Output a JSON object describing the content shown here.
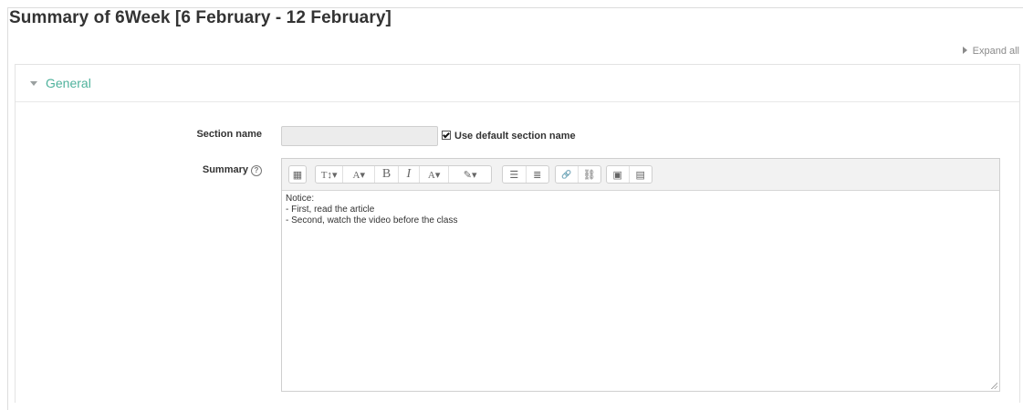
{
  "page": {
    "title": "Summary of 6Week [6 February - 12 February]",
    "expand_all": "Expand all"
  },
  "general": {
    "legend": "General"
  },
  "form": {
    "section_name_label": "Section name",
    "section_name_value": "",
    "use_default_label": "Use default section name",
    "use_default_checked": true,
    "summary_label": "Summary"
  },
  "toolbar": {
    "buttons": [
      {
        "name": "show-more-buttons",
        "glyph": "▦"
      },
      {
        "name": "paragraph-styles",
        "glyph": "T↕▾"
      },
      {
        "name": "text-style",
        "glyph": "A▾"
      },
      {
        "name": "bold",
        "glyph": "B"
      },
      {
        "name": "italic",
        "glyph": "I"
      },
      {
        "name": "font-color",
        "glyph": "A▾"
      },
      {
        "name": "background-color",
        "glyph": "✎▾"
      },
      {
        "name": "unordered-list",
        "glyph": "☰"
      },
      {
        "name": "ordered-list",
        "glyph": "≣"
      },
      {
        "name": "link",
        "glyph": "🔗"
      },
      {
        "name": "unlink",
        "glyph": "⛓"
      },
      {
        "name": "image",
        "glyph": "▣"
      },
      {
        "name": "media",
        "glyph": "▤"
      }
    ]
  },
  "editor": {
    "lines": [
      "Notice:",
      "- First, read the article",
      "- Second, watch the video before the class"
    ]
  }
}
